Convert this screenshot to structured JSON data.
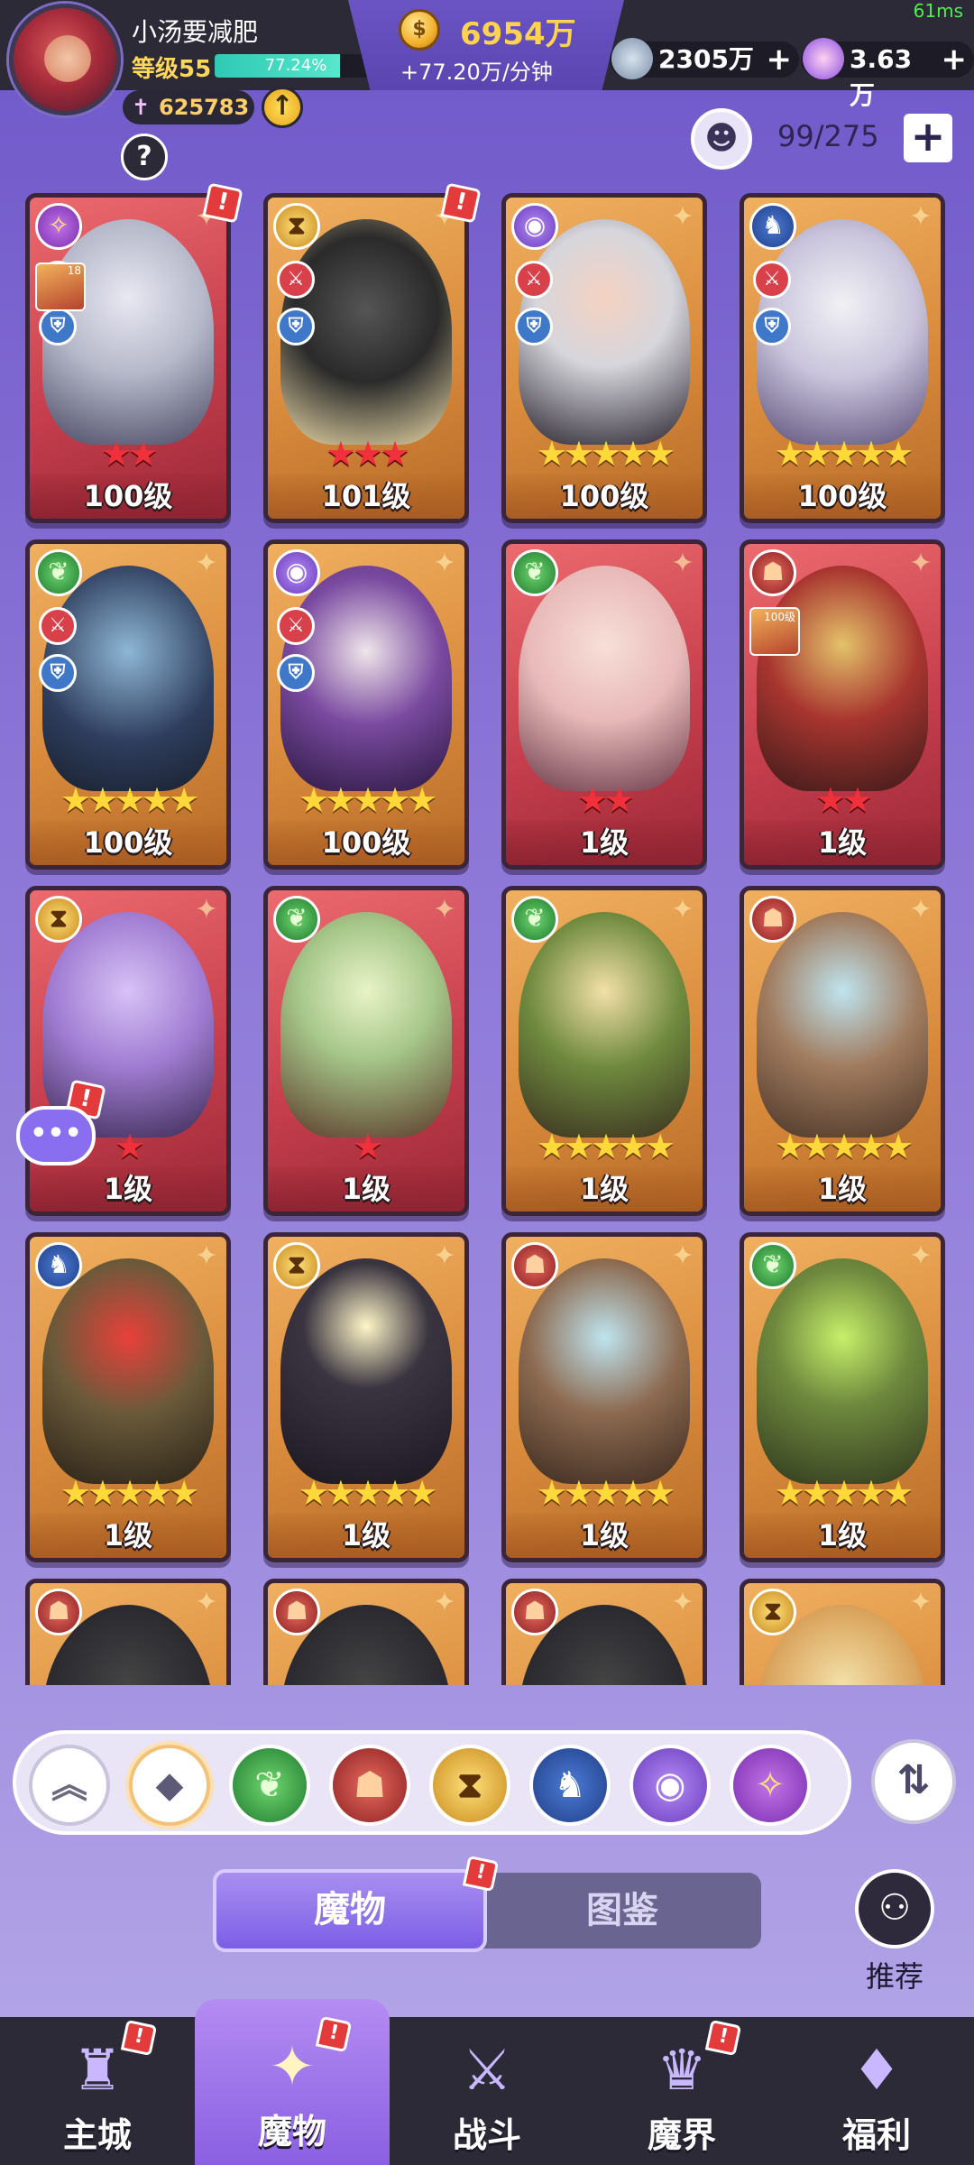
{
  "player": {
    "name": "小汤要减肥",
    "level": "等级55",
    "xp_percent_text": "77.24%",
    "xp_fraction": 0.7724,
    "power": "625783"
  },
  "currency": {
    "gold": "6954万",
    "gold_rate": "+77.20万/分钟",
    "res1": "2305万",
    "res2": "3.63万",
    "plus": "+"
  },
  "fps": "61ms",
  "help_label": "?",
  "capacity": {
    "text": "99/275",
    "plus": "+"
  },
  "cards": [
    {
      "bg": "red",
      "portrait": "p1",
      "element": "e-purple",
      "element_icon": "rune-icon",
      "stars": 2,
      "star_color": "red",
      "level": "100级",
      "slots": true,
      "alert": true,
      "mini_level": "18"
    },
    {
      "bg": "gold",
      "portrait": "p2",
      "element": "e-gold",
      "element_icon": "hourglass-icon",
      "stars": 3,
      "star_color": "red",
      "level": "101级",
      "slots": true,
      "alert": true
    },
    {
      "bg": "gold",
      "portrait": "p3",
      "element": "e-eye",
      "element_icon": "eye-icon",
      "stars": 5,
      "star_color": "gold",
      "level": "100级",
      "slots": true
    },
    {
      "bg": "gold",
      "portrait": "p4",
      "element": "e-blue",
      "element_icon": "dragon-icon",
      "stars": 5,
      "star_color": "gold",
      "level": "100级",
      "slots": true
    },
    {
      "bg": "gold",
      "portrait": "p5",
      "element": "e-green",
      "element_icon": "leaf-icon",
      "stars": 5,
      "star_color": "gold",
      "level": "100级",
      "slots": true
    },
    {
      "bg": "gold",
      "portrait": "p6",
      "element": "e-eye",
      "element_icon": "eye-icon",
      "stars": 5,
      "star_color": "gold",
      "level": "100级",
      "slots": true
    },
    {
      "bg": "red",
      "portrait": "p7",
      "element": "e-green",
      "element_icon": "leaf-icon",
      "stars": 2,
      "star_color": "red",
      "level": "1级"
    },
    {
      "bg": "red",
      "portrait": "p8",
      "element": "e-red",
      "element_icon": "demon-icon",
      "stars": 2,
      "star_color": "red",
      "level": "1级",
      "mini_level": "100级"
    },
    {
      "bg": "red",
      "portrait": "p9",
      "element": "e-gold",
      "element_icon": "hourglass-icon",
      "stars": 1,
      "star_color": "red",
      "level": "1级",
      "alert": true,
      "chat": true
    },
    {
      "bg": "red",
      "portrait": "p10",
      "element": "e-green",
      "element_icon": "leaf-icon",
      "stars": 1,
      "star_color": "red",
      "level": "1级"
    },
    {
      "bg": "gold",
      "portrait": "p11",
      "element": "e-green",
      "element_icon": "leaf-icon",
      "stars": 5,
      "star_color": "gold",
      "level": "1级"
    },
    {
      "bg": "gold",
      "portrait": "p12",
      "element": "e-red",
      "element_icon": "demon-icon",
      "stars": 5,
      "star_color": "gold",
      "level": "1级"
    },
    {
      "bg": "gold",
      "portrait": "p13",
      "element": "e-blue",
      "element_icon": "dragon-icon",
      "stars": 5,
      "star_color": "gold",
      "level": "1级"
    },
    {
      "bg": "gold",
      "portrait": "p14",
      "element": "e-gold",
      "element_icon": "hourglass-icon",
      "stars": 5,
      "star_color": "gold",
      "level": "1级"
    },
    {
      "bg": "gold",
      "portrait": "p15",
      "element": "e-red",
      "element_icon": "demon-icon",
      "stars": 5,
      "star_color": "gold",
      "level": "1级"
    },
    {
      "bg": "gold",
      "portrait": "p16",
      "element": "e-green",
      "element_icon": "leaf-icon",
      "stars": 5,
      "star_color": "gold",
      "level": "1级"
    },
    {
      "bg": "gold",
      "portrait": "p17",
      "element": "e-red",
      "element_icon": "demon-icon",
      "stars": 0,
      "star_color": "gold",
      "level": ""
    },
    {
      "bg": "gold",
      "portrait": "p17",
      "element": "e-red",
      "element_icon": "demon-icon",
      "stars": 0,
      "star_color": "gold",
      "level": ""
    },
    {
      "bg": "gold",
      "portrait": "p17",
      "element": "e-red",
      "element_icon": "demon-icon",
      "stars": 0,
      "star_color": "gold",
      "level": ""
    },
    {
      "bg": "gold",
      "portrait": "p18",
      "element": "e-gold",
      "element_icon": "hourglass-icon",
      "stars": 0,
      "star_color": "gold",
      "level": ""
    }
  ],
  "filters": [
    {
      "icon": "collapse-up-icon",
      "cls": "f-up",
      "glyph": "︽"
    },
    {
      "icon": "all-diamond-icon",
      "cls": "f-all",
      "glyph": "◆"
    },
    {
      "icon": "leaf-icon",
      "cls": "e-green",
      "glyph": "❦"
    },
    {
      "icon": "demon-icon",
      "cls": "e-red",
      "glyph": "☗"
    },
    {
      "icon": "hourglass-icon",
      "cls": "e-gold",
      "glyph": "⧗"
    },
    {
      "icon": "dragon-icon",
      "cls": "e-blue",
      "glyph": "♞"
    },
    {
      "icon": "eye-icon",
      "cls": "e-eye",
      "glyph": "◉"
    },
    {
      "icon": "rune-icon",
      "cls": "e-purple",
      "glyph": "✧"
    }
  ],
  "sort_icon": "sort-icon",
  "tabs": {
    "active": "魔物",
    "inactive": "图鉴"
  },
  "recommend_label": "推荐",
  "nav": [
    {
      "label": "主城",
      "icon": "castle-icon",
      "glyph": "♜",
      "alert": true
    },
    {
      "label": "魔物",
      "icon": "monster-flame-icon",
      "glyph": "✦",
      "alert": true,
      "active": true
    },
    {
      "label": "战斗",
      "icon": "battle-shield-icon",
      "glyph": "⚔"
    },
    {
      "label": "魔界",
      "icon": "demon-realm-icon",
      "glyph": "♛",
      "alert": true
    },
    {
      "label": "福利",
      "icon": "welfare-chest-icon",
      "glyph": "♦"
    }
  ],
  "alert_mark": "!"
}
